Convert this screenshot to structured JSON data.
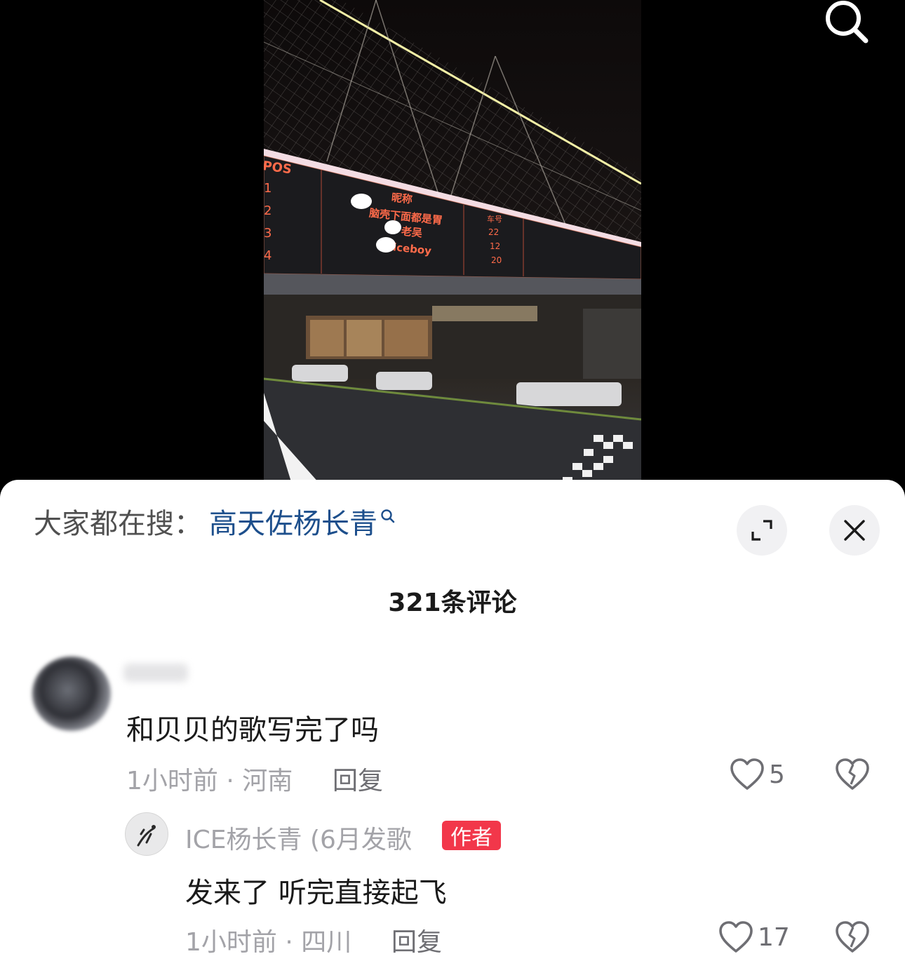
{
  "video": {
    "board_rows": [
      {
        "pos": "1",
        "name": "昵称",
        "car": "车号"
      },
      {
        "pos": "2",
        "name": "脑壳下面都是胃",
        "car": "22"
      },
      {
        "pos": "3",
        "name": "老吴",
        "car": "12"
      },
      {
        "pos": "4",
        "name": "iceboy",
        "car": "20"
      }
    ],
    "board_pos_header": "POS"
  },
  "search_suggest": {
    "prefix": "大家都在搜：",
    "keyword": "高天佐杨长青"
  },
  "comments_header": {
    "count_label": "321条评论"
  },
  "comments": [
    {
      "text": "和贝贝的歌写完了吗",
      "meta": "1小时前 · 河南",
      "reply_label": "回复",
      "likes": "5"
    }
  ],
  "reply": {
    "author": "ICE杨长青 (6月发歌",
    "badge": "作者",
    "text": "发来了 听完直接起飞",
    "meta": "1小时前 · 四川",
    "reply_label": "回复",
    "likes": "17"
  },
  "colors": {
    "keyword_link": "#1d4f8c",
    "author_badge": "#f2374a",
    "meta_gray": "#a3a3a8"
  }
}
